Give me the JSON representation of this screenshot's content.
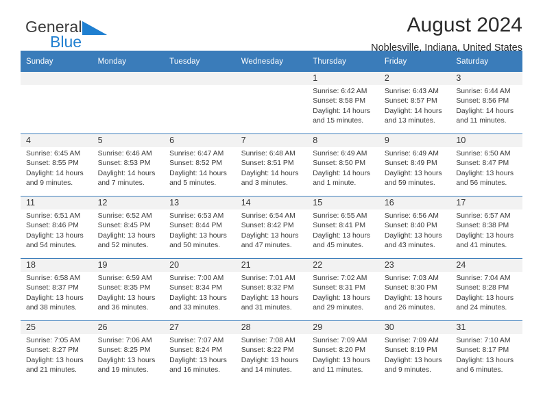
{
  "brand": {
    "name_part1": "General",
    "name_part2": "Blue",
    "triangle_icon": "triangle-icon",
    "triangle_color": "#1f7fd0",
    "text_color": "#3b3b3b"
  },
  "header": {
    "title": "August 2024",
    "subtitle": "Noblesville, Indiana, United States"
  },
  "theme": {
    "header_bg": "#3a7cba",
    "header_text": "#ffffff",
    "daynum_band": "#f2f2f2",
    "cell_bg": "#ffffff",
    "row_divider": "#3a7cba"
  },
  "calendar": {
    "weekday_headers": [
      "Sunday",
      "Monday",
      "Tuesday",
      "Wednesday",
      "Thursday",
      "Friday",
      "Saturday"
    ],
    "labels": {
      "sunrise": "Sunrise:",
      "sunset": "Sunset:",
      "daylight": "Daylight:"
    },
    "weeks": [
      [
        {
          "day": "",
          "sunrise": "",
          "sunset": "",
          "daylight": ""
        },
        {
          "day": "",
          "sunrise": "",
          "sunset": "",
          "daylight": ""
        },
        {
          "day": "",
          "sunrise": "",
          "sunset": "",
          "daylight": ""
        },
        {
          "day": "",
          "sunrise": "",
          "sunset": "",
          "daylight": ""
        },
        {
          "day": "1",
          "sunrise": "Sunrise: 6:42 AM",
          "sunset": "Sunset: 8:58 PM",
          "daylight": "Daylight: 14 hours and 15 minutes."
        },
        {
          "day": "2",
          "sunrise": "Sunrise: 6:43 AM",
          "sunset": "Sunset: 8:57 PM",
          "daylight": "Daylight: 14 hours and 13 minutes."
        },
        {
          "day": "3",
          "sunrise": "Sunrise: 6:44 AM",
          "sunset": "Sunset: 8:56 PM",
          "daylight": "Daylight: 14 hours and 11 minutes."
        }
      ],
      [
        {
          "day": "4",
          "sunrise": "Sunrise: 6:45 AM",
          "sunset": "Sunset: 8:55 PM",
          "daylight": "Daylight: 14 hours and 9 minutes."
        },
        {
          "day": "5",
          "sunrise": "Sunrise: 6:46 AM",
          "sunset": "Sunset: 8:53 PM",
          "daylight": "Daylight: 14 hours and 7 minutes."
        },
        {
          "day": "6",
          "sunrise": "Sunrise: 6:47 AM",
          "sunset": "Sunset: 8:52 PM",
          "daylight": "Daylight: 14 hours and 5 minutes."
        },
        {
          "day": "7",
          "sunrise": "Sunrise: 6:48 AM",
          "sunset": "Sunset: 8:51 PM",
          "daylight": "Daylight: 14 hours and 3 minutes."
        },
        {
          "day": "8",
          "sunrise": "Sunrise: 6:49 AM",
          "sunset": "Sunset: 8:50 PM",
          "daylight": "Daylight: 14 hours and 1 minute."
        },
        {
          "day": "9",
          "sunrise": "Sunrise: 6:49 AM",
          "sunset": "Sunset: 8:49 PM",
          "daylight": "Daylight: 13 hours and 59 minutes."
        },
        {
          "day": "10",
          "sunrise": "Sunrise: 6:50 AM",
          "sunset": "Sunset: 8:47 PM",
          "daylight": "Daylight: 13 hours and 56 minutes."
        }
      ],
      [
        {
          "day": "11",
          "sunrise": "Sunrise: 6:51 AM",
          "sunset": "Sunset: 8:46 PM",
          "daylight": "Daylight: 13 hours and 54 minutes."
        },
        {
          "day": "12",
          "sunrise": "Sunrise: 6:52 AM",
          "sunset": "Sunset: 8:45 PM",
          "daylight": "Daylight: 13 hours and 52 minutes."
        },
        {
          "day": "13",
          "sunrise": "Sunrise: 6:53 AM",
          "sunset": "Sunset: 8:44 PM",
          "daylight": "Daylight: 13 hours and 50 minutes."
        },
        {
          "day": "14",
          "sunrise": "Sunrise: 6:54 AM",
          "sunset": "Sunset: 8:42 PM",
          "daylight": "Daylight: 13 hours and 47 minutes."
        },
        {
          "day": "15",
          "sunrise": "Sunrise: 6:55 AM",
          "sunset": "Sunset: 8:41 PM",
          "daylight": "Daylight: 13 hours and 45 minutes."
        },
        {
          "day": "16",
          "sunrise": "Sunrise: 6:56 AM",
          "sunset": "Sunset: 8:40 PM",
          "daylight": "Daylight: 13 hours and 43 minutes."
        },
        {
          "day": "17",
          "sunrise": "Sunrise: 6:57 AM",
          "sunset": "Sunset: 8:38 PM",
          "daylight": "Daylight: 13 hours and 41 minutes."
        }
      ],
      [
        {
          "day": "18",
          "sunrise": "Sunrise: 6:58 AM",
          "sunset": "Sunset: 8:37 PM",
          "daylight": "Daylight: 13 hours and 38 minutes."
        },
        {
          "day": "19",
          "sunrise": "Sunrise: 6:59 AM",
          "sunset": "Sunset: 8:35 PM",
          "daylight": "Daylight: 13 hours and 36 minutes."
        },
        {
          "day": "20",
          "sunrise": "Sunrise: 7:00 AM",
          "sunset": "Sunset: 8:34 PM",
          "daylight": "Daylight: 13 hours and 33 minutes."
        },
        {
          "day": "21",
          "sunrise": "Sunrise: 7:01 AM",
          "sunset": "Sunset: 8:32 PM",
          "daylight": "Daylight: 13 hours and 31 minutes."
        },
        {
          "day": "22",
          "sunrise": "Sunrise: 7:02 AM",
          "sunset": "Sunset: 8:31 PM",
          "daylight": "Daylight: 13 hours and 29 minutes."
        },
        {
          "day": "23",
          "sunrise": "Sunrise: 7:03 AM",
          "sunset": "Sunset: 8:30 PM",
          "daylight": "Daylight: 13 hours and 26 minutes."
        },
        {
          "day": "24",
          "sunrise": "Sunrise: 7:04 AM",
          "sunset": "Sunset: 8:28 PM",
          "daylight": "Daylight: 13 hours and 24 minutes."
        }
      ],
      [
        {
          "day": "25",
          "sunrise": "Sunrise: 7:05 AM",
          "sunset": "Sunset: 8:27 PM",
          "daylight": "Daylight: 13 hours and 21 minutes."
        },
        {
          "day": "26",
          "sunrise": "Sunrise: 7:06 AM",
          "sunset": "Sunset: 8:25 PM",
          "daylight": "Daylight: 13 hours and 19 minutes."
        },
        {
          "day": "27",
          "sunrise": "Sunrise: 7:07 AM",
          "sunset": "Sunset: 8:24 PM",
          "daylight": "Daylight: 13 hours and 16 minutes."
        },
        {
          "day": "28",
          "sunrise": "Sunrise: 7:08 AM",
          "sunset": "Sunset: 8:22 PM",
          "daylight": "Daylight: 13 hours and 14 minutes."
        },
        {
          "day": "29",
          "sunrise": "Sunrise: 7:09 AM",
          "sunset": "Sunset: 8:20 PM",
          "daylight": "Daylight: 13 hours and 11 minutes."
        },
        {
          "day": "30",
          "sunrise": "Sunrise: 7:09 AM",
          "sunset": "Sunset: 8:19 PM",
          "daylight": "Daylight: 13 hours and 9 minutes."
        },
        {
          "day": "31",
          "sunrise": "Sunrise: 7:10 AM",
          "sunset": "Sunset: 8:17 PM",
          "daylight": "Daylight: 13 hours and 6 minutes."
        }
      ]
    ]
  }
}
